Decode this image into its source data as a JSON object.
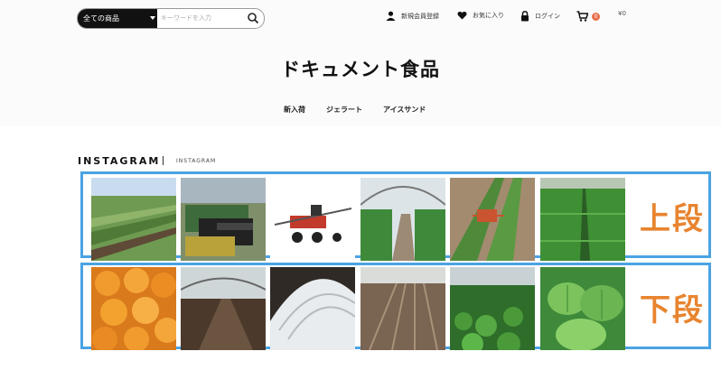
{
  "header": {
    "search": {
      "category": "全ての商品",
      "placeholder": "キーワードを入力"
    },
    "links": {
      "register": "新規会員登録",
      "favorite": "お気に入り",
      "login": "ログイン"
    },
    "cart": {
      "count": "0",
      "amount": "¥0"
    },
    "shop_title": "ドキュメント食品",
    "nav": [
      "新入荷",
      "ジェラート",
      "アイスサンド"
    ]
  },
  "instagram": {
    "title": "INSTAGRAM",
    "subtitle": "INSTAGRAM",
    "row_labels": {
      "top": "上段",
      "bottom": "下段"
    }
  },
  "colors": {
    "highlight_border": "#4aa3e3",
    "label_orange": "#e8842f",
    "badge": "#e8704a"
  }
}
